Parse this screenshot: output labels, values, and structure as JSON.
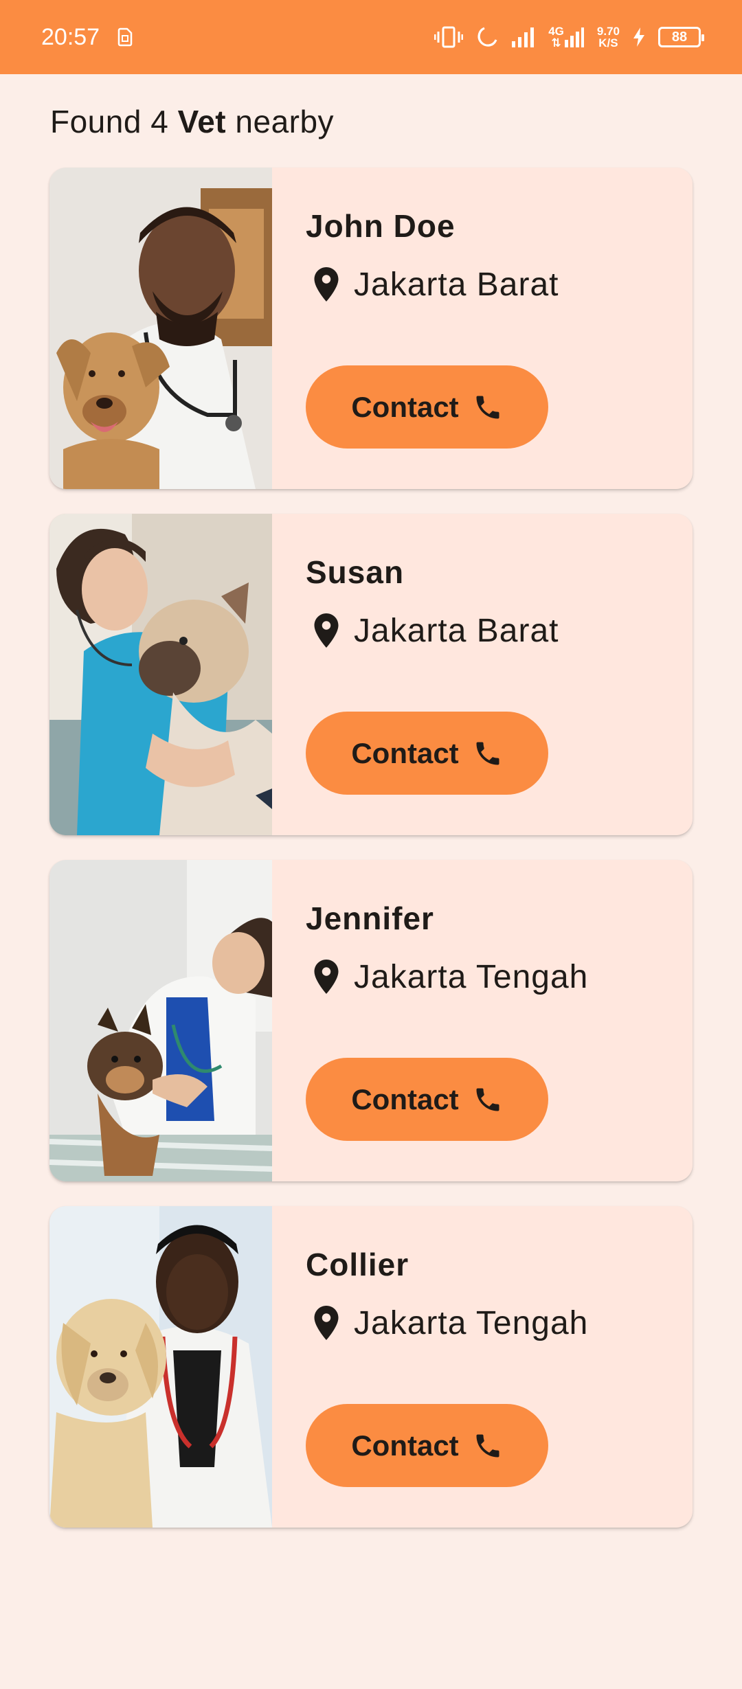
{
  "status_bar": {
    "time": "20:57",
    "net_speed_value": "9.70",
    "net_speed_unit": "K/S",
    "network_type": "4G",
    "battery_level": "88",
    "icons": [
      "sim-icon",
      "vibrate-icon",
      "moon-icon",
      "signal-icon",
      "data-arrows-icon",
      "charging-icon",
      "battery-icon"
    ]
  },
  "heading": {
    "prefix": "Found 4 ",
    "emphasis": "Vet",
    "suffix": " nearby"
  },
  "vets": [
    {
      "name": "John Doe",
      "location": "Jakarta Barat",
      "contact_label": "Contact"
    },
    {
      "name": "Susan",
      "location": "Jakarta Barat",
      "contact_label": "Contact"
    },
    {
      "name": "Jennifer",
      "location": "Jakarta Tengah",
      "contact_label": "Contact"
    },
    {
      "name": "Collier",
      "location": "Jakarta Tengah",
      "contact_label": "Contact"
    }
  ],
  "colors": {
    "accent": "#FB8C42",
    "background": "#FCEEE8",
    "card": "#FFE7DE",
    "text": "#1F1B18"
  }
}
